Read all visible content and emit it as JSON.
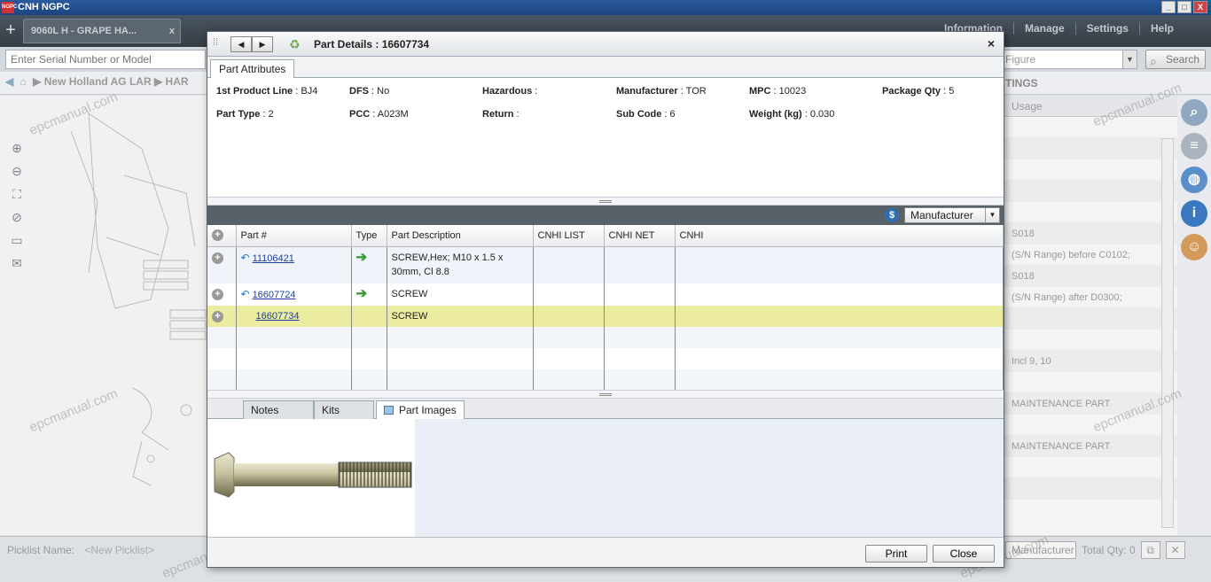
{
  "app": {
    "title": "CNH NGPC",
    "logo_text": "NGPC"
  },
  "window_controls": {
    "minimize": "_",
    "maximize": "□",
    "close": "X"
  },
  "toolbar": {
    "add_tab": "+",
    "tab_label": "9060L H - GRAPE HA...",
    "tab_close": "x",
    "menu": [
      "Information",
      "Manage",
      "Settings",
      "Help"
    ]
  },
  "search": {
    "serial_placeholder": "Enter Serial Number or Model",
    "figure_placeholder": "Figure",
    "search_label": "Search"
  },
  "breadcrumb": {
    "items": [
      "▶ New Holland AG LAR",
      "▶ HAR"
    ],
    "right_label": "TINGS"
  },
  "right_panel": {
    "header": "Usage",
    "rows": [
      "",
      "",
      "",
      "",
      "",
      "S018",
      "(S/N Range) before C0102;",
      "S018",
      "(S/N Range) after D0300;",
      "",
      "",
      "Incl 9, 10",
      "",
      "MAINTENANCE PART",
      "",
      "MAINTENANCE PART",
      "",
      ""
    ]
  },
  "bottom_bar": {
    "picklist_label": "Picklist Name:",
    "picklist_value": "<New Picklist>",
    "manufacturer": "Manufacturer",
    "total_qty": "Total Qty: 0"
  },
  "dialog": {
    "title": "Part Details : 16607734",
    "close": "×",
    "attr_tab": "Part Attributes",
    "attributes": [
      {
        "label": "1st Product Line",
        "value": "BJ4"
      },
      {
        "label": "DFS",
        "value": "No"
      },
      {
        "label": "Hazardous",
        "value": ""
      },
      {
        "label": "Manufacturer",
        "value": "TOR"
      },
      {
        "label": "MPC",
        "value": "10023"
      },
      {
        "label": "Package Qty",
        "value": "5"
      },
      {
        "label": "Part Type",
        "value": "2"
      },
      {
        "label": "PCC",
        "value": "A023M"
      },
      {
        "label": "Return",
        "value": ""
      },
      {
        "label": "Sub Code",
        "value": "6"
      },
      {
        "label": "Weight (kg)",
        "value": "0.030"
      }
    ],
    "price_source": "Manufacturer",
    "grid_headers": [
      "",
      "Part #",
      "Type",
      "Part Description",
      "CNHI LIST",
      "CNHI NET",
      "CNHI"
    ],
    "rows": [
      {
        "part": "11106421",
        "description": "SCREW,Hex; M10 x 1.5 x 30mm, Cl 8.8",
        "has_type": true,
        "has_back": true
      },
      {
        "part": "16607724",
        "description": "SCREW",
        "has_type": true,
        "has_back": true
      },
      {
        "part": "16607734",
        "description": "SCREW",
        "has_type": false,
        "has_back": false
      }
    ],
    "bottom_tabs": [
      "Notes",
      "Kits",
      "Part Images"
    ],
    "buttons": {
      "print": "Print",
      "close": "Close"
    }
  },
  "watermark": "epcmanual.com",
  "colors": {
    "highlight_row": "#ececa0",
    "link": "#1a3fa8",
    "title_bar": "#2a5a9c"
  }
}
